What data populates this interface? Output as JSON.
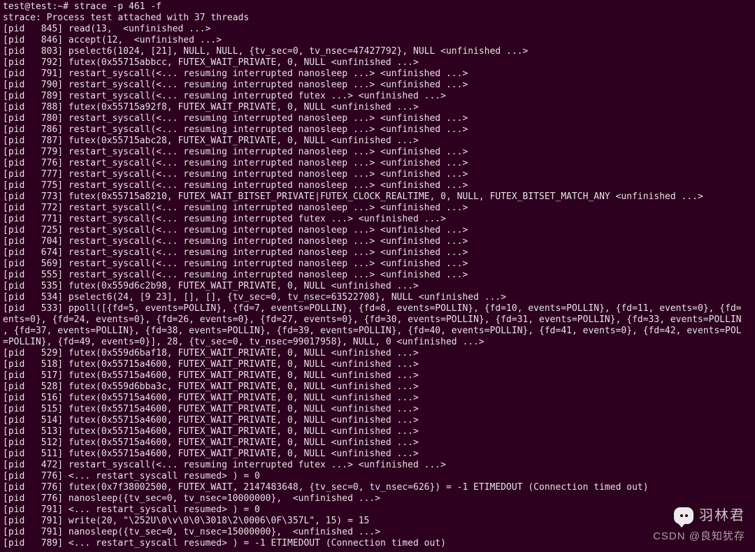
{
  "colors": {
    "bg": "#2c001e",
    "fg": "#e8e0e7"
  },
  "lines": [
    "test@test:~# strace -p 461 -f",
    "strace: Process test attached with 37 threads",
    "[pid   845] read(13,  <unfinished ...>",
    "[pid   846] accept(12,  <unfinished ...>",
    "[pid   803] pselect6(1024, [21], NULL, NULL, {tv_sec=0, tv_nsec=47427792}, NULL <unfinished ...>",
    "[pid   792] futex(0x55715abbcc, FUTEX_WAIT_PRIVATE, 0, NULL <unfinished ...>",
    "[pid   791] restart_syscall(<... resuming interrupted nanosleep ...> <unfinished ...>",
    "[pid   790] restart_syscall(<... resuming interrupted nanosleep ...> <unfinished ...>",
    "[pid   789] restart_syscall(<... resuming interrupted futex ...> <unfinished ...>",
    "[pid   788] futex(0x55715a92f8, FUTEX_WAIT_PRIVATE, 0, NULL <unfinished ...>",
    "[pid   780] restart_syscall(<... resuming interrupted nanosleep ...> <unfinished ...>",
    "[pid   786] restart_syscall(<... resuming interrupted nanosleep ...> <unfinished ...>",
    "[pid   787] futex(0x55715abc28, FUTEX_WAIT_PRIVATE, 0, NULL <unfinished ...>",
    "[pid   779] restart_syscall(<... resuming interrupted nanosleep ...> <unfinished ...>",
    "[pid   776] restart_syscall(<... resuming interrupted nanosleep ...> <unfinished ...>",
    "[pid   777] restart_syscall(<... resuming interrupted nanosleep ...> <unfinished ...>",
    "[pid   775] restart_syscall(<... resuming interrupted nanosleep ...> <unfinished ...>",
    "[pid   773] futex(0x55715a8210, FUTEX_WAIT_BITSET_PRIVATE|FUTEX_CLOCK_REALTIME, 0, NULL, FUTEX_BITSET_MATCH_ANY <unfinished ...>",
    "[pid   772] restart_syscall(<... resuming interrupted nanosleep ...> <unfinished ...>",
    "[pid   771] restart_syscall(<... resuming interrupted futex ...> <unfinished ...>",
    "[pid   725] restart_syscall(<... resuming interrupted nanosleep ...> <unfinished ...>",
    "[pid   704] restart_syscall(<... resuming interrupted nanosleep ...> <unfinished ...>",
    "[pid   674] restart_syscall(<... resuming interrupted nanosleep ...> <unfinished ...>",
    "[pid   569] restart_syscall(<... resuming interrupted nanosleep ...> <unfinished ...>",
    "[pid   555] restart_syscall(<... resuming interrupted nanosleep ...> <unfinished ...>",
    "[pid   535] futex(0x559d6c2b98, FUTEX_WAIT_PRIVATE, 0, NULL <unfinished ...>",
    "[pid   534] pselect6(24, [9 23], [], [], {tv_sec=0, tv_nsec=63522708}, NULL <unfinished ...>",
    "[pid   533] ppoll([{fd=5, events=POLLIN}, {fd=7, events=POLLIN}, {fd=8, events=POLLIN}, {fd=10, events=POLLIN}, {fd=11, events=0}, {fd=",
    "ents=0}, {fd=24, events=0}, {fd=26, events=0}, {fd=27, events=0}, {fd=30, events=POLLIN}, {fd=31, events=POLLIN}, {fd=33, events=POLLIN",
    ", {fd=37, events=POLLIN}, {fd=38, events=POLLIN}, {fd=39, events=POLLIN}, {fd=40, events=POLLIN}, {fd=41, events=0}, {fd=42, events=POL",
    "=POLLIN}, {fd=49, events=0}], 28, {tv_sec=0, tv_nsec=99017958}, NULL, 0 <unfinished ...>",
    "[pid   529] futex(0x559d6baf18, FUTEX_WAIT_PRIVATE, 0, NULL <unfinished ...>",
    "[pid   518] futex(0x55715a4600, FUTEX_WAIT_PRIVATE, 0, NULL <unfinished ...>",
    "[pid   517] futex(0x55715a4600, FUTEX_WAIT_PRIVATE, 0, NULL <unfinished ...>",
    "[pid   528] futex(0x559d6bba3c, FUTEX_WAIT_PRIVATE, 0, NULL <unfinished ...>",
    "[pid   516] futex(0x55715a4600, FUTEX_WAIT_PRIVATE, 0, NULL <unfinished ...>",
    "[pid   515] futex(0x55715a4600, FUTEX_WAIT_PRIVATE, 0, NULL <unfinished ...>",
    "[pid   514] futex(0x55715a4600, FUTEX_WAIT_PRIVATE, 0, NULL <unfinished ...>",
    "[pid   513] futex(0x55715a4600, FUTEX_WAIT_PRIVATE, 0, NULL <unfinished ...>",
    "[pid   512] futex(0x55715a4600, FUTEX_WAIT_PRIVATE, 0, NULL <unfinished ...>",
    "[pid   511] futex(0x55715a4600, FUTEX_WAIT_PRIVATE, 0, NULL <unfinished ...>",
    "[pid   472] restart_syscall(<... resuming interrupted futex ...> <unfinished ...>",
    "[pid   776] <... restart_syscall resumed> ) = 0",
    "[pid   776] futex(0x7f38002500, FUTEX_WAIT, 2147483648, {tv_sec=0, tv_nsec=626}) = -1 ETIMEDOUT (Connection timed out)",
    "[pid   776] nanosleep({tv_sec=0, tv_nsec=10000000},  <unfinished ...>",
    "[pid   791] <... restart_syscall resumed> ) = 0",
    "[pid   791] write(20, \"\\252U\\0\\v\\0\\0\\3018\\2\\0006\\0F\\357L\", 15) = 15",
    "[pid   791] nanosleep({tv_sec=0, tv_nsec=15000000},  <unfinished ...>",
    "[pid   789] <... restart_syscall resumed> ) = -1 ETIMEDOUT (Connection timed out)"
  ],
  "watermark": {
    "top": "羽林君",
    "bottom": "CSDN @良知犹存"
  }
}
